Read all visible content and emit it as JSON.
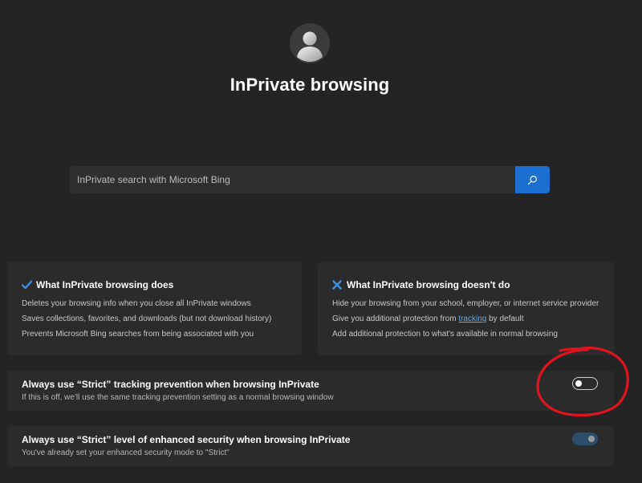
{
  "page": {
    "title": "InPrivate browsing"
  },
  "icons": {
    "avatar": "avatar-icon",
    "search": "search-icon",
    "check": "checkmark-icon",
    "cross": "cross-icon"
  },
  "search": {
    "placeholder": "InPrivate search with Microsoft Bing"
  },
  "does_card": {
    "heading": "What InPrivate browsing does",
    "items": [
      "Deletes your browsing info when you close all InPrivate windows",
      "Saves collections, favorites, and downloads (but not download history)",
      "Prevents Microsoft Bing searches from being associated with you"
    ]
  },
  "doesnt_card": {
    "heading": "What InPrivate browsing doesn't do",
    "item1": "Hide your browsing from your school, employer, or internet service provider",
    "item2_before": "Give you additional protection from ",
    "item2_link": "tracking",
    "item2_after": " by default",
    "item3": "Add additional protection to what's available in normal browsing"
  },
  "settings": [
    {
      "title": "Always use “Strict” tracking prevention when browsing InPrivate",
      "description": "If this is off, we'll use the same tracking prevention setting as a normal browsing window",
      "toggle_on": false
    },
    {
      "title": "Always use “Strict” level of enhanced security when browsing InPrivate",
      "description": "You've already set your enhanced security mode to \"Strict\"",
      "toggle_on": true
    }
  ],
  "colors": {
    "background": "#242424",
    "card": "#2b2b2b",
    "accent": "#1a6fd1",
    "check": "#3d8fe0",
    "annotation": "#e0141e"
  }
}
